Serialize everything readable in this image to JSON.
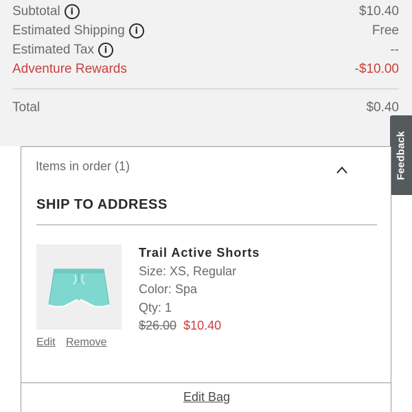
{
  "summary": {
    "subtotal_label": "Subtotal",
    "subtotal_value": "$10.40",
    "shipping_label": "Estimated Shipping",
    "shipping_value": "Free",
    "tax_label": "Estimated Tax",
    "tax_value": "--",
    "rewards_label": "Adventure Rewards",
    "rewards_value": "-$10.00",
    "total_label": "Total",
    "total_value": "$0.40",
    "info_icon_glyph": "i"
  },
  "feedback": {
    "label": "Feedback"
  },
  "order": {
    "items_header": "Items in order (1)",
    "ship_title": "SHIP TO ADDRESS",
    "product": {
      "name": "Trail Active Shorts",
      "size": "Size: XS, Regular",
      "color": "Color: Spa",
      "qty": "Qty: 1",
      "price_original": "$26.00",
      "price_sale": "$10.40",
      "edit_label": "Edit",
      "remove_label": "Remove",
      "image_icon": "shorts-icon"
    },
    "edit_bag_label": "Edit Bag"
  },
  "colors": {
    "summary_bg": "#f2f2f2",
    "rewards_red": "#c8403f",
    "feedback_bg": "#555a5d",
    "shorts_teal": "#7fd8cf"
  }
}
